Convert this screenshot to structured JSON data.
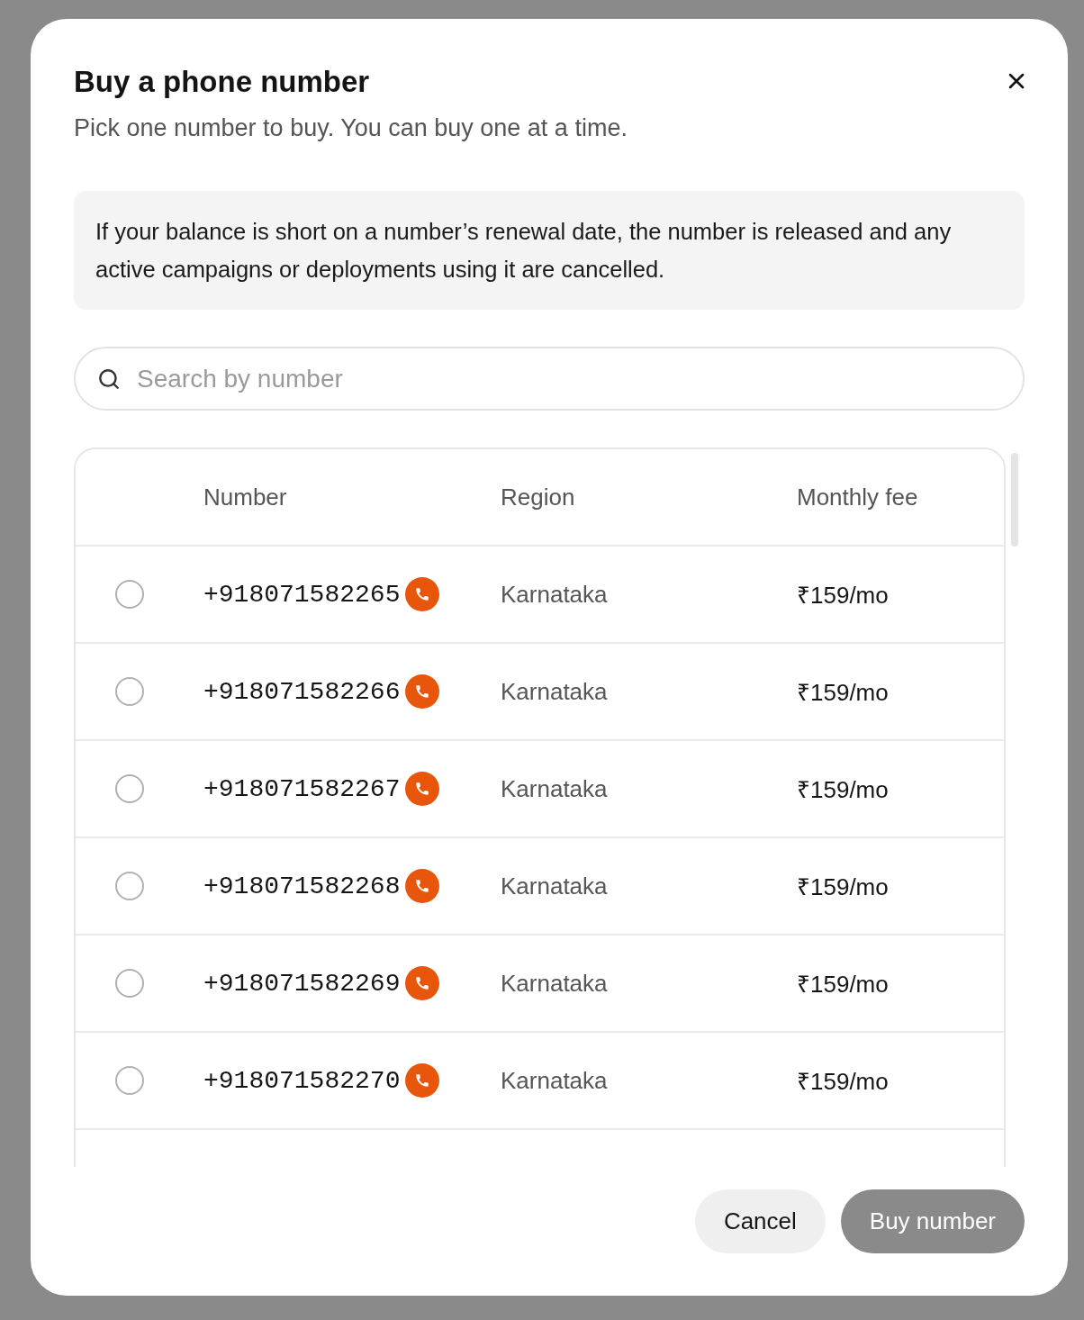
{
  "dialog": {
    "title": "Buy a phone number",
    "subtitle": "Pick one number to buy. You can buy one at a time."
  },
  "notice": "If your balance is short on a number’s renewal date, the number is released and any active campaigns or deployments using it are cancelled.",
  "search": {
    "placeholder": "Search by number"
  },
  "table": {
    "columns": [
      "Number",
      "Region",
      "Monthly fee"
    ],
    "rows": [
      {
        "selected": false,
        "number": "+918071582265",
        "region": "Karnataka",
        "fee": "₹159/mo"
      },
      {
        "selected": false,
        "number": "+918071582266",
        "region": "Karnataka",
        "fee": "₹159/mo"
      },
      {
        "selected": false,
        "number": "+918071582267",
        "region": "Karnataka",
        "fee": "₹159/mo"
      },
      {
        "selected": false,
        "number": "+918071582268",
        "region": "Karnataka",
        "fee": "₹159/mo"
      },
      {
        "selected": false,
        "number": "+918071582269",
        "region": "Karnataka",
        "fee": "₹159/mo"
      },
      {
        "selected": false,
        "number": "+918071582270",
        "region": "Karnataka",
        "fee": "₹159/mo"
      }
    ]
  },
  "buttons": [
    {
      "label": "Cancel",
      "kind": "secondary",
      "disabled": false
    },
    {
      "label": "Buy number",
      "kind": "primary",
      "disabled": true
    }
  ]
}
